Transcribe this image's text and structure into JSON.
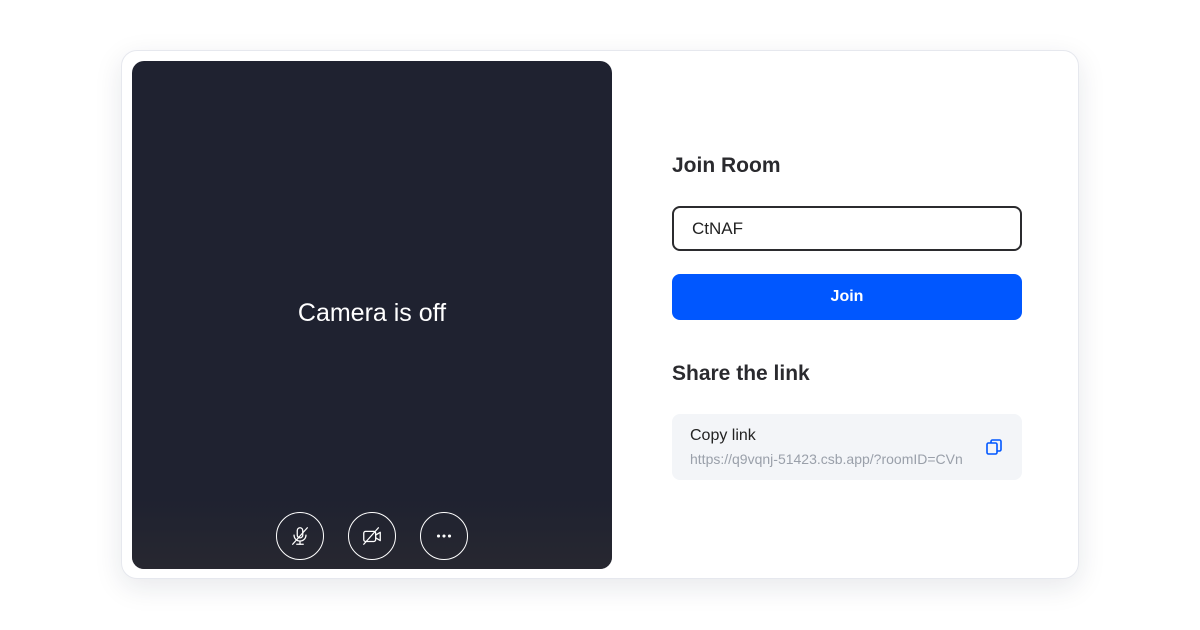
{
  "video": {
    "status_text": "Camera is off",
    "controls": [
      {
        "name": "mic-off-icon"
      },
      {
        "name": "camera-off-icon"
      },
      {
        "name": "more-icon"
      }
    ]
  },
  "join": {
    "title": "Join Room",
    "room_input_value": "CtNAF",
    "button_label": "Join"
  },
  "share": {
    "title": "Share the link",
    "copy_label": "Copy link",
    "url": "https://q9vqnj-51423.csb.app/?roomID=CVn",
    "copy_icon": "copy-icon"
  },
  "colors": {
    "accent": "#0057ff",
    "video_bg": "#1f2230",
    "copy_icon": "#0057ff"
  }
}
